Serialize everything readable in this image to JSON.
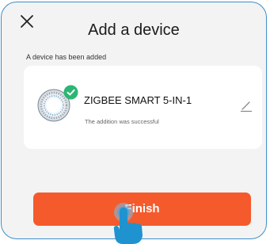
{
  "dialog": {
    "title": "Add a device",
    "subtitle": "A device has been added"
  },
  "device": {
    "name": "ZIGBEE SMART 5-IN-1",
    "status": "The addition was successful"
  },
  "actions": {
    "finish_label": "Finish"
  },
  "colors": {
    "accent": "#f55a2c",
    "success": "#2bb673",
    "frame_border": "#3d8fc9",
    "hand": "#1f93cf"
  },
  "icons": {
    "close": "close-icon",
    "device": "zigbee-sensor-icon",
    "check": "check-badge-icon",
    "edit": "pencil-icon",
    "hand": "tap-hand-icon"
  }
}
